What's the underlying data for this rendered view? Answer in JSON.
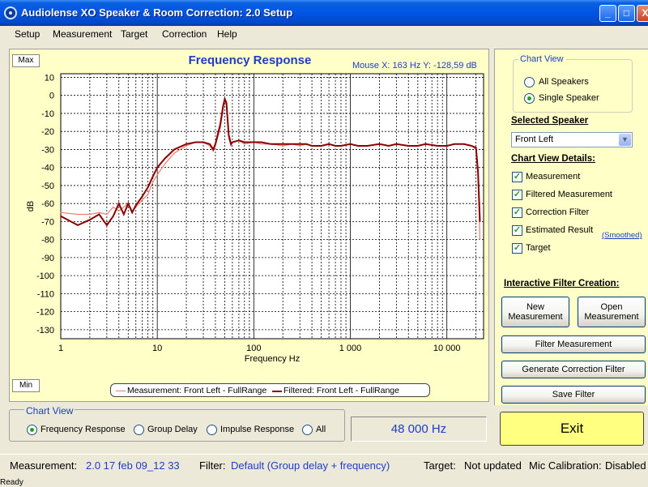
{
  "window": {
    "title": "Audiolense XO Speaker & Room Correction: 2.0 Setup",
    "buttons": {
      "minimize": "_",
      "maximize": "□",
      "close": "X"
    }
  },
  "menu": [
    "Setup",
    "Measurement",
    "Target",
    "Correction",
    "Help"
  ],
  "chart": {
    "max_button": "Max",
    "min_button": "Min",
    "mouse_readout": "Mouse X: 163 Hz   Y: -128,59 dB"
  },
  "chart_data": {
    "type": "line",
    "title": "Frequency Response",
    "xlabel": "Frequency Hz",
    "ylabel": "dB",
    "xscale": "log",
    "xlim": [
      1,
      24000
    ],
    "ylim": [
      -135,
      12
    ],
    "x_ticks": [
      1,
      10,
      100,
      1000,
      10000
    ],
    "x_tick_labels": [
      "1",
      "10",
      "100",
      "1 000",
      "10 000"
    ],
    "y_ticks": [
      10,
      0,
      -10,
      -20,
      -30,
      -40,
      -50,
      -60,
      -70,
      -80,
      -90,
      -100,
      -110,
      -120,
      -130
    ],
    "grid": true,
    "legend_placement": "bottom-center",
    "series": [
      {
        "name": "Measurement: Front Left - FullRange",
        "color": "#F07C70",
        "x": [
          1,
          1.5,
          2,
          2.5,
          3,
          3.5,
          4,
          4.5,
          5,
          5.5,
          6,
          7,
          8,
          9,
          10,
          12,
          15,
          20,
          25,
          30,
          35,
          38,
          40,
          45,
          48,
          50,
          52,
          55,
          58,
          60,
          70,
          80,
          100,
          120,
          150,
          200,
          250,
          300,
          350,
          400,
          500,
          600,
          700,
          800,
          1000,
          1200,
          1500,
          2000,
          2500,
          3000,
          4000,
          5000,
          6000,
          8000,
          10000,
          12000,
          15000,
          18000,
          20000,
          21000,
          22000
        ],
        "y": [
          -65,
          -66,
          -66,
          -65,
          -66,
          -62,
          -64,
          -62,
          -60,
          -64,
          -62,
          -58,
          -55,
          -48,
          -44,
          -38,
          -32,
          -28,
          -26,
          -26,
          -28,
          -31,
          -28,
          -18,
          -8,
          -2,
          -6,
          -24,
          -28,
          -26,
          -25,
          -27,
          -26,
          -27,
          -27,
          -28,
          -27,
          -28,
          -27,
          -28,
          -28,
          -27,
          -28,
          -28,
          -27,
          -28,
          -28,
          -27,
          -28,
          -27,
          -28,
          -28,
          -27,
          -28,
          -28,
          -27,
          -27,
          -28,
          -30,
          -45,
          -80
        ]
      },
      {
        "name": "Filtered: Front Left - FullRange",
        "color": "#8B0000",
        "x": [
          1,
          1.5,
          2,
          2.5,
          3,
          3.5,
          4,
          4.5,
          5,
          5.5,
          6,
          7,
          8,
          9,
          10,
          12,
          15,
          20,
          25,
          30,
          35,
          38,
          40,
          45,
          48,
          50,
          52,
          55,
          58,
          60,
          70,
          80,
          100,
          120,
          150,
          200,
          250,
          300,
          350,
          400,
          500,
          600,
          700,
          800,
          1000,
          1200,
          1500,
          2000,
          2500,
          3000,
          4000,
          5000,
          6000,
          8000,
          10000,
          12000,
          15000,
          18000,
          20000,
          21000,
          22000
        ],
        "y": [
          -67,
          -72,
          -69,
          -66,
          -72,
          -67,
          -60,
          -66,
          -60,
          -65,
          -61,
          -56,
          -51,
          -45,
          -40,
          -35,
          -30,
          -27,
          -26,
          -26,
          -27,
          -30,
          -27,
          -16,
          -6,
          -2,
          -4,
          -22,
          -27,
          -26,
          -25,
          -26,
          -26,
          -26,
          -27,
          -27,
          -27,
          -27,
          -27,
          -28,
          -28,
          -27,
          -28,
          -28,
          -27,
          -28,
          -28,
          -27,
          -28,
          -27,
          -28,
          -28,
          -27,
          -28,
          -28,
          -27,
          -27,
          -28,
          -29,
          -42,
          -70
        ]
      }
    ]
  },
  "right_panel": {
    "chart_view_title": "Chart View",
    "chart_view_options": [
      {
        "label": "All Speakers",
        "selected": false
      },
      {
        "label": "Single Speaker",
        "selected": true
      }
    ],
    "selected_speaker_title": "Selected Speaker",
    "selected_speaker_value": "Front Left",
    "chart_view_details_title": "Chart View Details:",
    "details": [
      {
        "label": "Measurement",
        "checked": true
      },
      {
        "label": "Filtered Measurement",
        "checked": true
      },
      {
        "label": "Correction Filter",
        "checked": true
      },
      {
        "label": "Estimated Result",
        "checked": true
      },
      {
        "label": "Target",
        "checked": true
      }
    ],
    "smoothed_link": "(Smoothed)",
    "interactive_title": "Interactive Filter Creation:",
    "buttons": {
      "new_measurement": [
        "New",
        "Measurement"
      ],
      "open_measurement": [
        "Open",
        "Measurement"
      ],
      "filter_measurement": "Filter Measurement",
      "generate_correction_filter": "Generate Correction Filter",
      "save_filter": "Save Filter"
    }
  },
  "bottom": {
    "chart_view_title": "Chart View",
    "options": [
      {
        "label": "Frequency Response",
        "selected": true
      },
      {
        "label": "Group Delay",
        "selected": false
      },
      {
        "label": "Impulse Response",
        "selected": false
      },
      {
        "label": "All",
        "selected": false
      }
    ],
    "sample_rate": "48 000 Hz",
    "exit_label": "Exit"
  },
  "status": {
    "measurement_label": "Measurement:",
    "measurement_value": "2.0 17 feb 09_12 33",
    "filter_label": "Filter:",
    "filter_value": "Default (Group delay  + frequency)",
    "target_label": "Target:",
    "target_value": "Not updated",
    "mic_label": "Mic Calibration:",
    "mic_value": "Disabled",
    "ready": "Ready"
  }
}
